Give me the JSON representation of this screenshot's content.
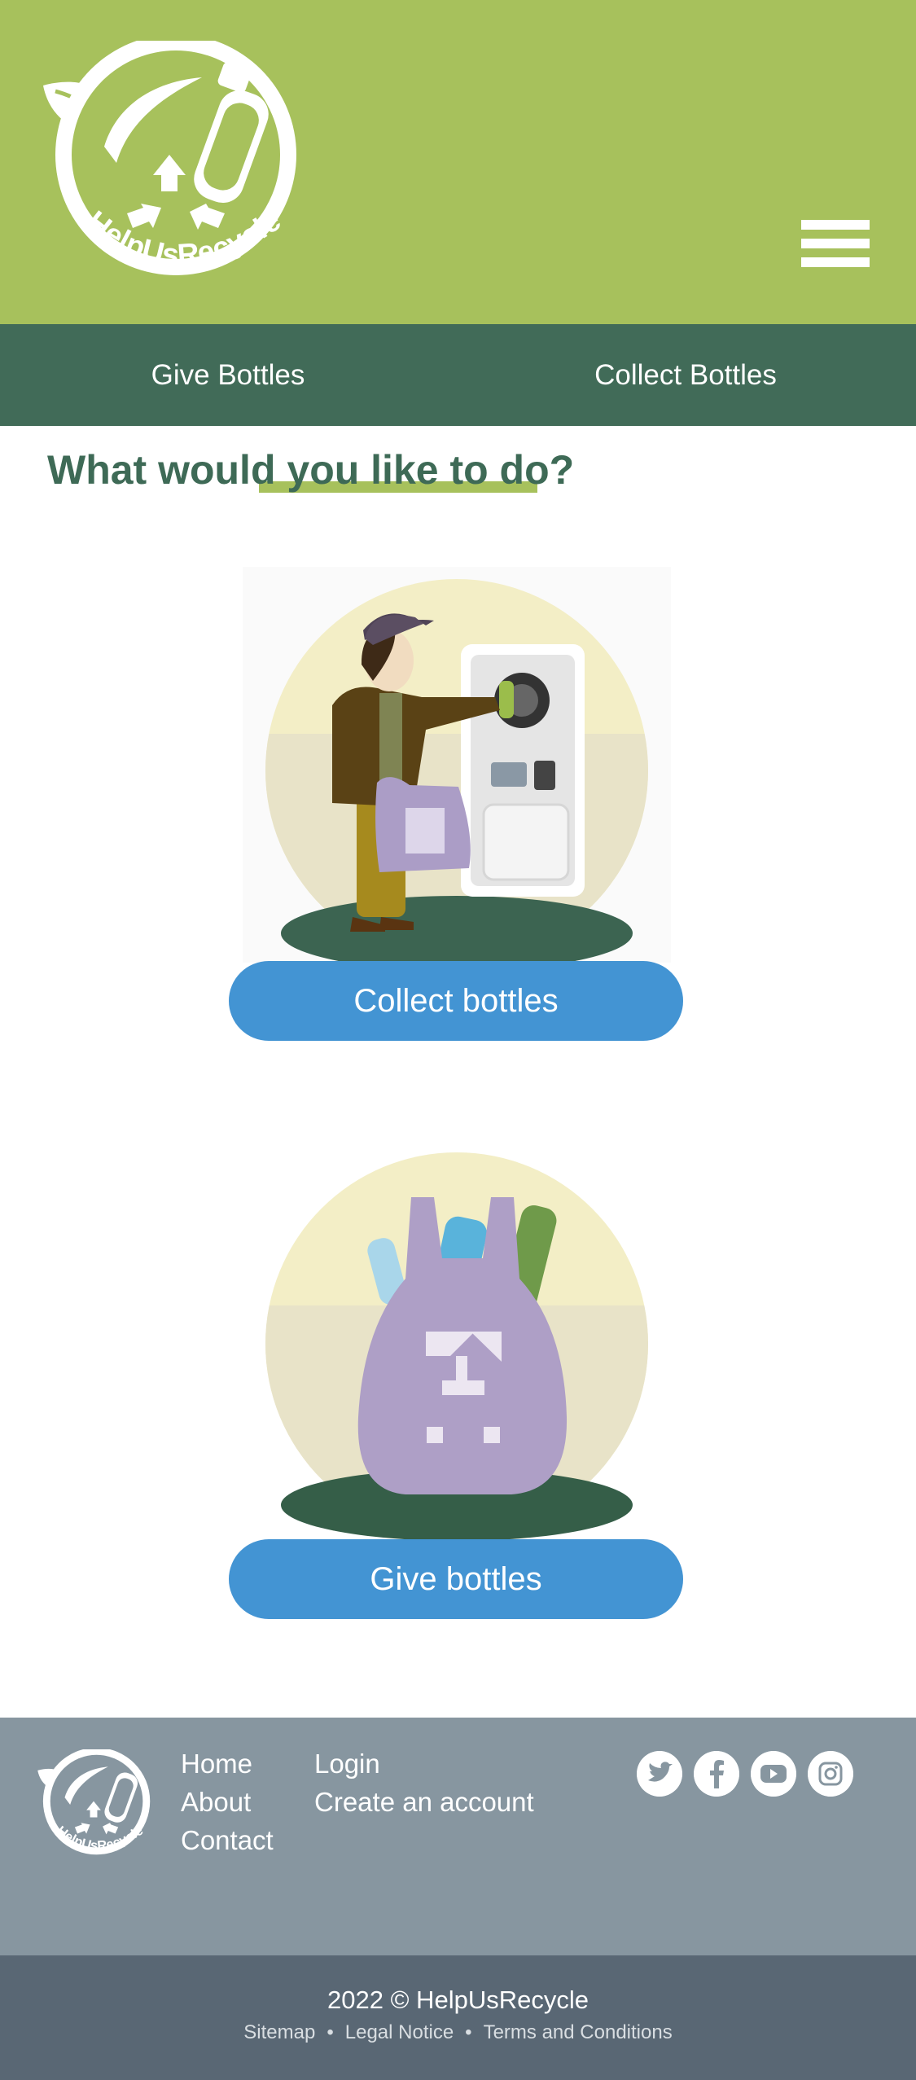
{
  "colors": {
    "header_green": "#a7c15c",
    "nav_green": "#416b58",
    "heading_green": "#3e6a56",
    "button_blue": "#4394d3",
    "footer_grey": "#8796a0",
    "footer_dark": "#596774"
  },
  "header": {
    "logo_text": "HelpUsRecycle",
    "menu_icon": "hamburger-menu-icon"
  },
  "nav": {
    "give_bottles": "Give Bottles",
    "collect_bottles": "Collect Bottles"
  },
  "main": {
    "heading": "What would you like to do?",
    "collect_button": "Collect bottles",
    "give_button": "Give bottles"
  },
  "footer": {
    "logo_text": "HelpUsRecycle",
    "col1": [
      "Home",
      "About",
      "Contact"
    ],
    "col2": [
      "Login",
      "Create an account"
    ],
    "social_icons": [
      "twitter-icon",
      "facebook-icon",
      "youtube-icon",
      "instagram-icon"
    ],
    "copyright": "2022 © HelpUsRecycle",
    "legal": [
      "Sitemap",
      "Legal Notice",
      "Terms and Conditions"
    ]
  }
}
